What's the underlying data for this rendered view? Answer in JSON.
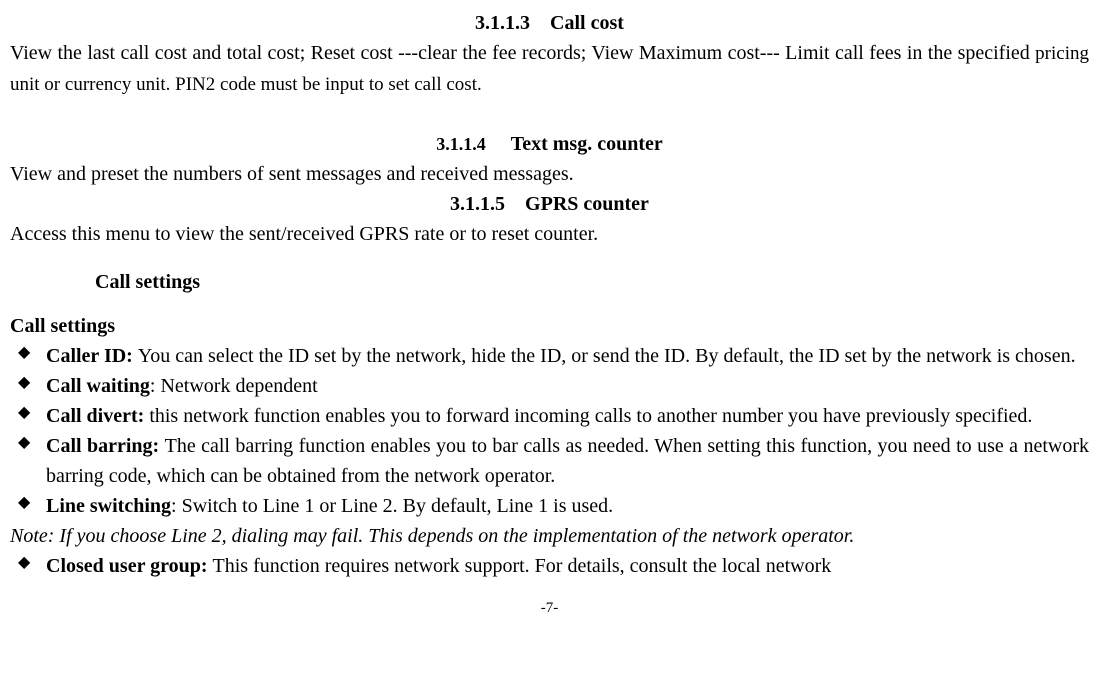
{
  "section_3_1_1_3": {
    "number": "3.1.1.3",
    "title": "Call cost",
    "body_part1": "View the last call cost and total cost; Reset cost ---clear the fee records; View Maximum cost--- Limit call fees in the specified ",
    "body_part2": "pricing unit or currency unit. PIN2 code must be input to set call cost."
  },
  "section_3_1_1_4": {
    "number": "3.1.1.4",
    "title": "Text msg. counter",
    "body": "View and preset the numbers of sent messages and received messages."
  },
  "section_3_1_1_5": {
    "number": "3.1.1.5",
    "title": "GPRS counter",
    "body": "Access this menu to view the sent/received GPRS rate or to reset counter."
  },
  "call_settings": {
    "heading": "Call settings",
    "subheading": "Call settings",
    "items": [
      {
        "label": "Caller ID: ",
        "text": "You can select the ID set by the network, hide the ID, or send the ID. By default, the ID set by the network is chosen."
      },
      {
        "label": "Call waiting",
        "text": ": Network dependent"
      },
      {
        "label": "Call divert: ",
        "text": "this network function enables you to forward incoming calls to another number you have previously specified."
      },
      {
        "label": "Call barring: ",
        "text": "The call barring function enables you to bar calls as needed. When setting this function, you need to use a network barring code, which can be obtained from the network operator."
      },
      {
        "label": "Line switching",
        "text": ": Switch to Line 1 or Line 2. By default, Line 1 is used."
      }
    ],
    "note": "Note: If you choose Line 2, dialing may fail. This depends on the implementation of the network operator.",
    "item_after_note": {
      "label": "Closed user group: ",
      "text": "This function requires network support. For details, consult the local network"
    }
  },
  "page_number": "-7-"
}
